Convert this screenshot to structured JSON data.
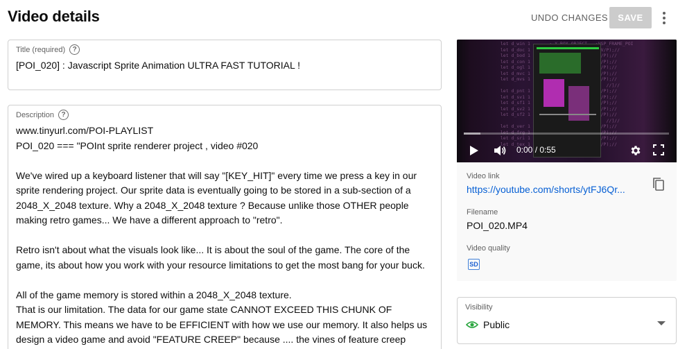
{
  "header": {
    "title": "Video details",
    "undo_label": "UNDO CHANGES",
    "save_label": "SAVE"
  },
  "title_field": {
    "label": "Title (required)",
    "help": "?",
    "value": "[POI_020] : Javascript Sprite Animation ULTRA FAST TUTORIAL !"
  },
  "description_field": {
    "label": "Description",
    "help": "?",
    "value": "www.tinyurl.com/POI-PLAYLIST\nPOI_020 === \"POInt sprite renderer project , video #020\n\nWe've wired up a keyboard listener that will say \"[KEY_HIT]\" every time we press a key in our sprite rendering project. Our sprite data is eventually going to be stored in a sub-section of a 2048_X_2048 texture. Why a 2048_X_2048 texture ? Because unlike those OTHER people making retro games... We have a different approach to \"retro\".\n\nRetro isn't about what the visuals look like... It is about the soul of the game. The core of the game, its about how you work with your resource limitations to get the most bang for your buck.\n\nAll of the game memory is stored within a 2048_X_2048 texture.\nThat is our limitation. The data for our game state CANNOT EXCEED THIS CHUNK OF MEMORY. This means we have to be EFFICIENT with how we use our memory. It also helps us design a video game and avoid \"FEATURE CREEP\" because .... the vines of feature creep cannot spread across"
  },
  "player": {
    "time": "0:00 / 0:55",
    "progress_played": 0.0,
    "progress_buffered": 0.08,
    "icons": {
      "play": "play-icon",
      "volume": "volume-icon",
      "settings": "gear-icon",
      "fullscreen": "fullscreen-icon"
    }
  },
  "video_info": {
    "link_label": "Video link",
    "link_value": "https://youtube.com/shorts/ytFJ6Qr...",
    "filename_label": "Filename",
    "filename_value": "POI_020.MP4",
    "quality_label": "Video quality",
    "quality_badge": "SD"
  },
  "visibility": {
    "label": "Visibility",
    "value": "Public"
  },
  "colors": {
    "accent_link": "#065fd4",
    "save_disabled": "#cccccc",
    "visibility_eye": "#2ba640",
    "progress": "#ff0000"
  }
}
